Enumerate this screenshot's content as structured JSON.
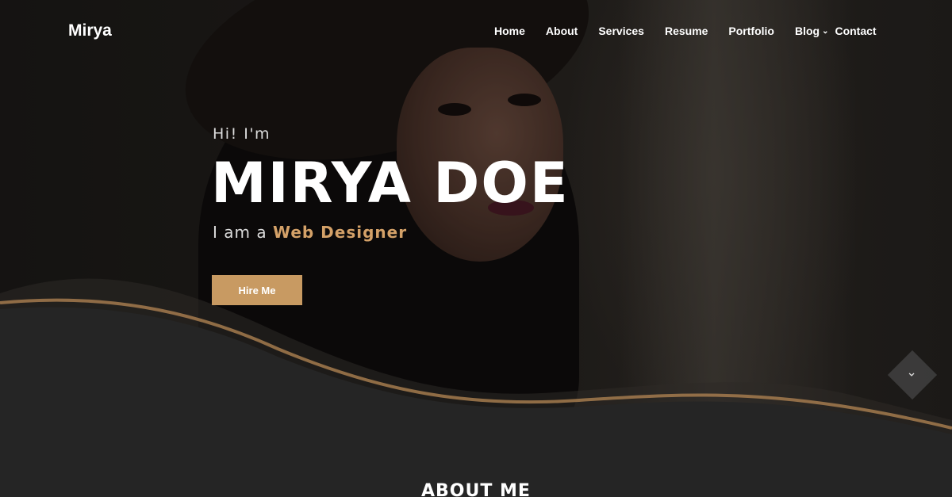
{
  "brand": {
    "name": "Mirya"
  },
  "nav": {
    "items": [
      {
        "label": "Home"
      },
      {
        "label": "About"
      },
      {
        "label": "Services"
      },
      {
        "label": "Resume"
      },
      {
        "label": "Portfolio"
      },
      {
        "label": "Blog",
        "dropdown_icon": "chevron-down-icon"
      },
      {
        "label": "Contact"
      }
    ]
  },
  "hero": {
    "greeting": "Hi! I'm",
    "name": "MIRYA DOE",
    "role_prefix": "I am a",
    "role_highlight": "Web Designer",
    "cta_label": "Hire Me",
    "scroll_icon": "chevron-down-icon"
  },
  "sections": {
    "about_title": "ABOUT ME"
  },
  "colors": {
    "accent": "#c89a62",
    "highlight_text": "#d4a168",
    "background_dark": "#252525",
    "text_primary": "#ffffff"
  }
}
